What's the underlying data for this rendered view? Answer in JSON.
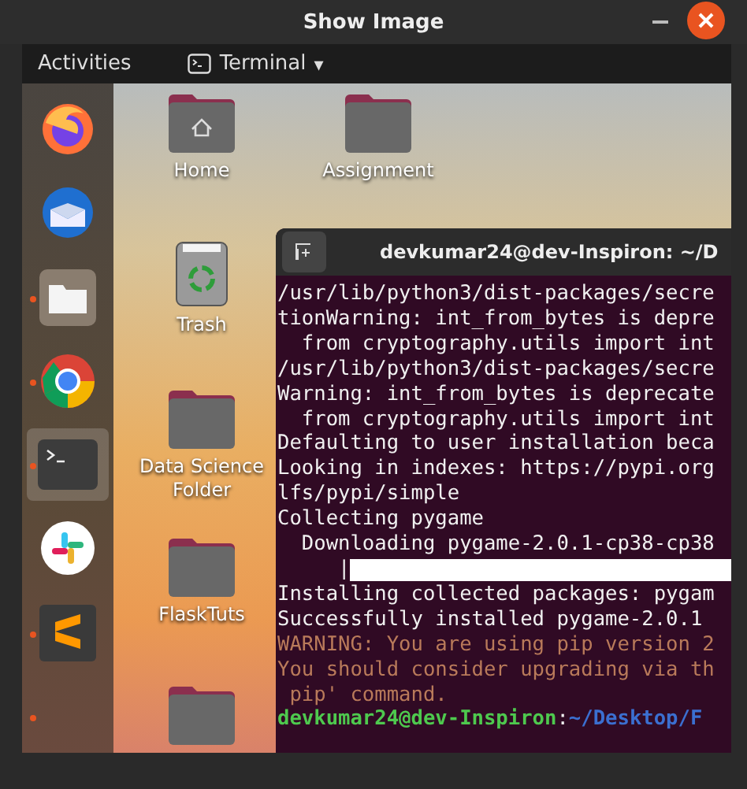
{
  "window": {
    "title": "Show Image"
  },
  "top_bar": {
    "activities": "Activities",
    "app_menu": "Terminal",
    "app_menu_caret": "▾"
  },
  "dock": [
    {
      "kind": "firefox",
      "running": false,
      "selected": false
    },
    {
      "kind": "mail",
      "running": false,
      "selected": false
    },
    {
      "kind": "files",
      "running": true,
      "selected": false
    },
    {
      "kind": "chrome",
      "running": true,
      "selected": false
    },
    {
      "kind": "terminal",
      "running": true,
      "selected": true
    },
    {
      "kind": "slack",
      "running": false,
      "selected": false
    },
    {
      "kind": "sublime",
      "running": true,
      "selected": false
    },
    {
      "kind": "hidden",
      "running": true,
      "selected": false
    }
  ],
  "desktop_icons": [
    {
      "kind": "home",
      "label": "Home"
    },
    {
      "kind": "folder",
      "label": "Assignment"
    },
    {
      "kind": "trash",
      "label": "Trash"
    },
    {
      "kind": "folder",
      "label": "Data Science Folder"
    },
    {
      "kind": "folder",
      "label": "FlaskTuts"
    },
    {
      "kind": "folder"
    }
  ],
  "terminal": {
    "title": "devkumar24@dev-Inspiron: ~/D",
    "lines": [
      {
        "kind": "text",
        "text": "/usr/lib/python3/dist-packages/secre"
      },
      {
        "kind": "text",
        "text": "tionWarning: int_from_bytes is depre"
      },
      {
        "kind": "text",
        "text": "  from cryptography.utils import int"
      },
      {
        "kind": "text",
        "text": "/usr/lib/python3/dist-packages/secre"
      },
      {
        "kind": "text",
        "text": "Warning: int_from_bytes is deprecate"
      },
      {
        "kind": "text",
        "text": "  from cryptography.utils import int"
      },
      {
        "kind": "text",
        "text": "Defaulting to user installation beca"
      },
      {
        "kind": "text",
        "text": "Looking in indexes: https://pypi.org"
      },
      {
        "kind": "text",
        "text": "lfs/pypi/simple"
      },
      {
        "kind": "text",
        "text": "Collecting pygame"
      },
      {
        "kind": "text",
        "text": "  Downloading pygame-2.0.1-cp38-cp38"
      },
      {
        "kind": "progress",
        "text": "     |"
      },
      {
        "kind": "text",
        "text": "Installing collected packages: pygam"
      },
      {
        "kind": "text",
        "text": "Successfully installed pygame-2.0.1"
      },
      {
        "kind": "warning",
        "text": "WARNING: You are using pip version 2"
      },
      {
        "kind": "warning",
        "text": "You should consider upgrading via th"
      },
      {
        "kind": "warning",
        "text": " pip' command."
      },
      {
        "kind": "prompt",
        "user": "devkumar24@dev-Inspiron",
        "sep": ":",
        "path": "~/Desktop/F"
      }
    ]
  }
}
